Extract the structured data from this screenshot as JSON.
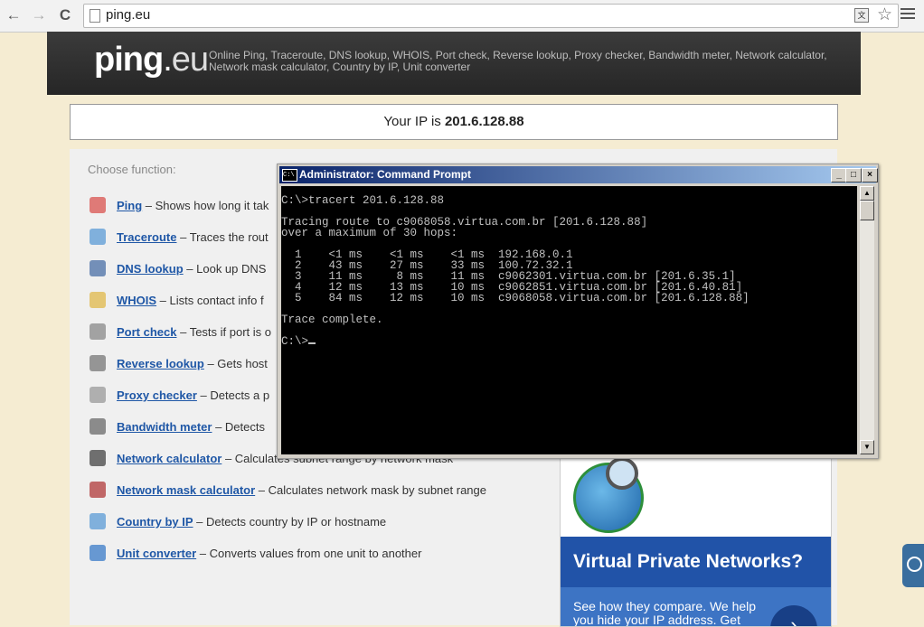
{
  "browser": {
    "url": "ping.eu",
    "back_glyph": "←",
    "forward_glyph": "→",
    "reload_glyph": "C",
    "star_glyph": "☆",
    "translate_glyph": "文"
  },
  "site": {
    "logo_main": "ping",
    "logo_dot": ".",
    "logo_tld": "eu",
    "tagline": "Online Ping, Traceroute, DNS lookup, WHOIS, Port check, Reverse lookup, Proxy checker, Bandwidth meter, Network calculator, Network mask calculator, Country by IP, Unit converter",
    "ip_prefix": "Your IP is ",
    "ip_value": "201.6.128.88",
    "choose_label": "Choose function:"
  },
  "functions": [
    {
      "name": "Ping",
      "desc": " – Shows how long it tak",
      "icon": "ping-icon",
      "color": "#d9534f"
    },
    {
      "name": "Traceroute",
      "desc": " – Traces the rout",
      "icon": "traceroute-icon",
      "color": "#5b9bd5"
    },
    {
      "name": "DNS lookup",
      "desc": " – Look up DNS",
      "icon": "dns-icon",
      "color": "#4a6fa5"
    },
    {
      "name": "WHOIS",
      "desc": " – Lists contact info f",
      "icon": "whois-icon",
      "color": "#e0b84a"
    },
    {
      "name": "Port check",
      "desc": " – Tests if port is o",
      "icon": "port-icon",
      "color": "#888888"
    },
    {
      "name": "Reverse lookup",
      "desc": " – Gets host",
      "icon": "reverse-icon",
      "color": "#777777"
    },
    {
      "name": "Proxy checker",
      "desc": " – Detects a p",
      "icon": "proxy-icon",
      "color": "#999999"
    },
    {
      "name": "Bandwidth meter",
      "desc": " – Detects",
      "icon": "bandwidth-icon",
      "color": "#6a6a6a"
    },
    {
      "name": "Network calculator",
      "desc": " – Calculates subnet range by network mask",
      "icon": "calculator-icon",
      "color": "#444444"
    },
    {
      "name": "Network mask calculator",
      "desc": " – Calculates network mask by subnet range",
      "icon": "mask-calculator-icon",
      "color": "#b03a3a"
    },
    {
      "name": "Country by IP",
      "desc": " – Detects country by IP or hostname",
      "icon": "country-icon",
      "color": "#5b9bd5"
    },
    {
      "name": "Unit converter",
      "desc": " – Converts values from one unit to another",
      "icon": "converter-icon",
      "color": "#3a7bc8"
    }
  ],
  "ad": {
    "title": "Virtual Private Networks?",
    "text": "See how they compare. We help you hide your IP address. Get",
    "arrow": "›"
  },
  "cmd": {
    "title": "Administrator: Command Prompt",
    "icon_text": "C:\\",
    "minimize": "_",
    "maximize": "□",
    "close": "×",
    "scroll_up": "▲",
    "scroll_down": "▼",
    "output": "C:\\>tracert 201.6.128.88\n\nTracing route to c9068058.virtua.com.br [201.6.128.88]\nover a maximum of 30 hops:\n\n  1    <1 ms    <1 ms    <1 ms  192.168.0.1\n  2    43 ms    27 ms    33 ms  100.72.32.1\n  3    11 ms     8 ms    11 ms  c9062301.virtua.com.br [201.6.35.1]\n  4    12 ms    13 ms    10 ms  c9062851.virtua.com.br [201.6.40.81]\n  5    84 ms    12 ms    10 ms  c9068058.virtua.com.br [201.6.128.88]\n\nTrace complete.\n\nC:\\>"
  }
}
